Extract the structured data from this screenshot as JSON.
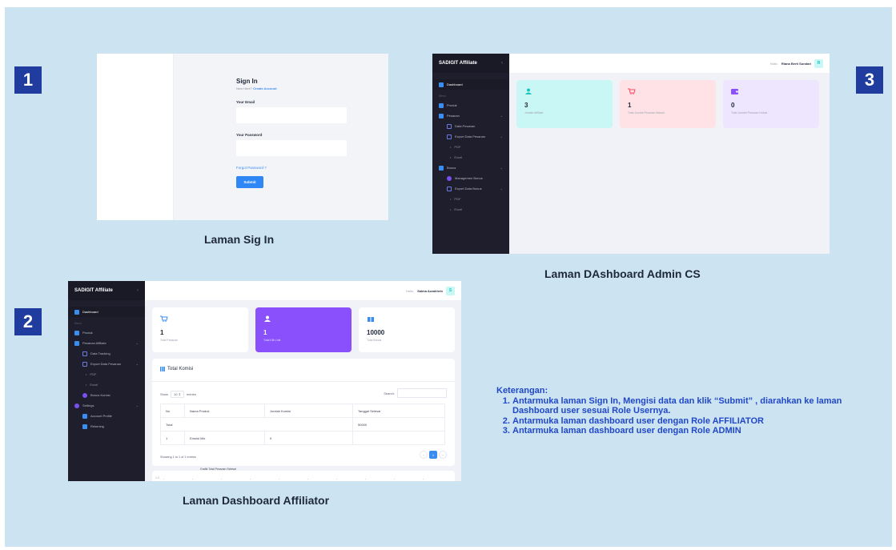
{
  "steps": [
    "1",
    "2",
    "3"
  ],
  "captions": {
    "signin": "Laman Sig In",
    "admin": "Laman DAshboard Admin CS",
    "affiliator": "Laman Dashboard Affiliator"
  },
  "signin": {
    "title": "Sign In",
    "new_here": "New Here?",
    "create_account": "Create Account",
    "email_label": "Your Email",
    "password_label": "Your Password",
    "forgot": "Forgot Password ?",
    "submit": "Submit"
  },
  "admin": {
    "brand": "SADIGIT Affiliate",
    "greeting": "Hallo,",
    "user": "Riana Berti Sundari",
    "avatar": "R",
    "section": "Menu",
    "menu": {
      "dashboard": "Dashboard",
      "produk": "Produk",
      "pesanan": "Pesanan",
      "data_pesanan": "Data Pesanan",
      "export_pesanan": "Export Data Pesanan",
      "pdf": "PDF",
      "excel": "Excel",
      "bonus": "Bonus",
      "manajemen_bonus": "Managemen Bonus",
      "export_bonus": "Export Data Bonus",
      "pdf2": "PDF",
      "excel2": "Excel"
    },
    "cards": [
      {
        "value": "3",
        "label": "Jumlah Affiliate"
      },
      {
        "value": "1",
        "label": "Total Jumlah Pesanan Masuk"
      },
      {
        "value": "0",
        "label": "Total Jumlah Pesanan Keluar"
      }
    ],
    "colors": {
      "card1": "#c9f7f5",
      "card2": "#ffe2e5",
      "card3": "#eee5ff"
    }
  },
  "affiliator": {
    "brand": "SADIGIT Affiliate",
    "greeting": "Hallo,",
    "user": "Salma Azzahhrin",
    "avatar": "S",
    "section": "Menu",
    "menu": {
      "dashboard": "Dashboard",
      "produk": "Produk",
      "pesanan": "Pesanan Affiliate",
      "data_tracking": "Data Tracking",
      "export_pesanan": "Export Data Pesanan",
      "pdf": "PDF",
      "excel": "Excel",
      "bonus_komisi": "Bonus Komisi",
      "settings": "Settings",
      "account_profile": "Account Profile",
      "rekening": "Rekening"
    },
    "cards": [
      {
        "value": "1",
        "label": "Total Pesanan"
      },
      {
        "value": "1",
        "label": "Total Klik Link"
      },
      {
        "value": "10000",
        "label": "Total Bonus"
      }
    ],
    "panel": {
      "title": "Total Komisi",
      "show": "Show",
      "show_value": "10",
      "entries": "entries",
      "search": "Search:",
      "headers": [
        "No",
        "Nama Produk",
        "Jumlah Komisi",
        "Tanggal Selesai"
      ],
      "total_label": "Total",
      "total_value": "50000",
      "row": [
        "1",
        "Emulsi Mix",
        "0",
        ""
      ],
      "showing": "Showing 1 to 1 of 1 entries",
      "page_prev": "‹",
      "page_current": "1",
      "page_next": "›",
      "graph_title": "Grafik Total Pesanan Selesai",
      "graph_axis": "1.0"
    }
  },
  "notes": {
    "heading": "Keterangan:",
    "items": [
      "Antarmuka laman Sign In, Mengisi data dan klik “Submit” , diarahkan ke laman Dashboard user sesuai Role Usernya.",
      "Antarmuka laman dashboard user dengan Role AFFILIATOR",
      "Antarmuka laman dashboard user dengan Role ADMIN"
    ]
  }
}
